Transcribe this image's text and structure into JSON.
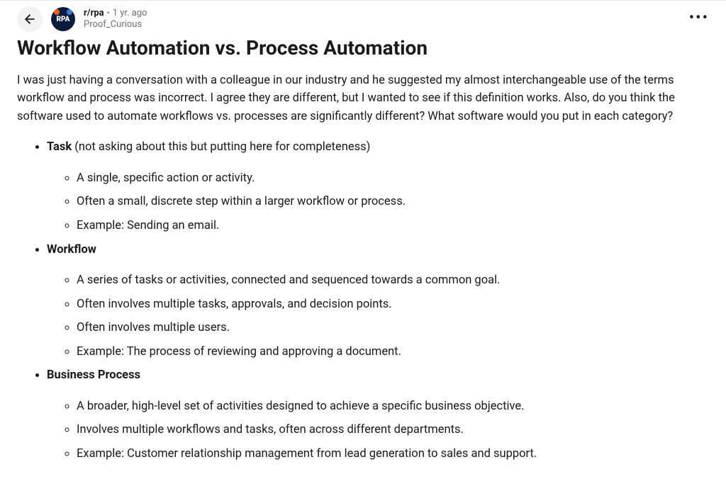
{
  "header": {
    "subreddit": "r/rpa",
    "separator": "•",
    "time": "1 yr. ago",
    "username": "Proof_Curious",
    "avatar_label": "RPA"
  },
  "post": {
    "title": "Workflow Automation vs. Process Automation",
    "intro": "I was just having a conversation with a colleague in our industry and he suggested my almost interchangeable use of the terms workflow and process was incorrect. I agree they are different, but I wanted to see if this definition works. Also, do you think the software used to automate workflows vs. processes are significantly different? What software would you put in each category?",
    "definitions": [
      {
        "term": "Task",
        "note": " (not asking about this but putting here for completeness)",
        "points": [
          "A single, specific action or activity.",
          "Often a small, discrete step within a larger workflow or process.",
          "Example: Sending an email."
        ]
      },
      {
        "term": "Workflow",
        "note": "",
        "points": [
          "A series of tasks or activities, connected and sequenced towards a common goal.",
          "Often involves multiple tasks, approvals, and decision points.",
          "Often involves multiple users.",
          "Example: The process of reviewing and approving a document."
        ]
      },
      {
        "term": "Business Process",
        "note": "",
        "points": [
          "A broader, high-level set of activities designed to achieve a specific business objective.",
          "Involves multiple workflows and tasks, often across different departments.",
          "Example: Customer relationship management from lead generation to sales and support."
        ]
      }
    ]
  }
}
